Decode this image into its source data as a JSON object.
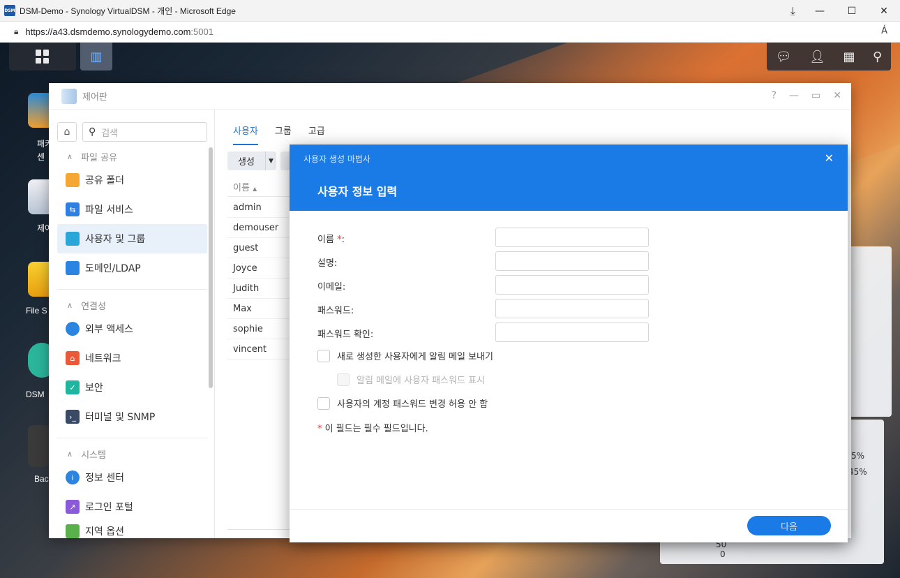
{
  "browser": {
    "title": "DSM-Demo - Synology VirtualDSM - 개인 - Microsoft Edge",
    "favicon": "DSM",
    "url_main": "https://a43.dsmdemo.synologydemo.com",
    "url_port": ":5001",
    "read_aloud": "Á"
  },
  "desktop": {
    "icons": [
      {
        "label": "패키\n센",
        "icon": "package-center-icon"
      },
      {
        "label": "제어",
        "icon": "control-panel-icon"
      },
      {
        "label": "File S",
        "icon": "file-station-icon"
      },
      {
        "label": "DSM",
        "icon": "dsm-help-icon"
      },
      {
        "label": "Bac",
        "icon": "backup-icon"
      }
    ],
    "widget_values": [
      "5%",
      "45%",
      "50",
      "0"
    ]
  },
  "control_panel": {
    "title": "제어판",
    "help": "?",
    "search_placeholder": "검색",
    "sections": {
      "file_sharing": "파일 공유",
      "connectivity": "연결성",
      "system": "시스템"
    },
    "items": {
      "shared_folder": "공유 폴더",
      "file_services": "파일 서비스",
      "user_group": "사용자 및 그룹",
      "domain_ldap": "도메인/LDAP",
      "external_access": "외부 액세스",
      "network": "네트워크",
      "security": "보안",
      "terminal_snmp": "터미널 및 SNMP",
      "info_center": "정보 센터",
      "login_portal": "로그인 포털",
      "partial": "지역 옵션"
    },
    "tabs": [
      "사용자",
      "그룹",
      "고급"
    ],
    "create_button": "생성",
    "column_name": "이름",
    "users": [
      "admin",
      "demouser",
      "guest",
      "Joyce",
      "Judith",
      "Max",
      "sophie",
      "vincent"
    ]
  },
  "dialog": {
    "wizard_title": "사용자 생성 마법사",
    "step_title": "사용자 정보 입력",
    "fields": {
      "name": "이름",
      "name_req": "*",
      "name_colon": ":",
      "description": "설명:",
      "email": "이메일:",
      "password": "패스워드:",
      "confirm_password": "패스워드 확인:"
    },
    "values": {
      "name": "",
      "description": "",
      "email": "",
      "password": "",
      "confirm_password": ""
    },
    "checkboxes": {
      "send_mail": "새로 생성한 사용자에게 알림 메일 보내기",
      "show_password": "알림 메일에 사용자 패스워드 표시",
      "disallow_change": "사용자의 계정 패스워드 변경 허용 안 함"
    },
    "note_star": "*",
    "note_text": " 이 필드는 필수 필드입니다.",
    "next_button": "다음"
  }
}
